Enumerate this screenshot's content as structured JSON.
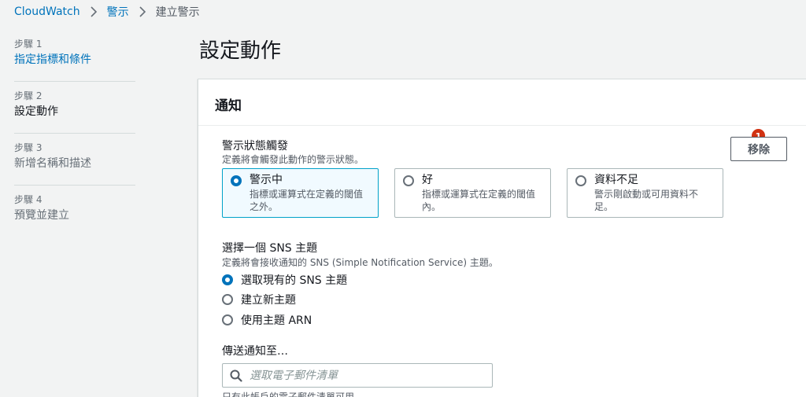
{
  "breadcrumb": {
    "items": [
      "CloudWatch",
      "警示",
      "建立警示"
    ]
  },
  "steps": [
    {
      "num": "步驟 1",
      "label": "指定指標和條件"
    },
    {
      "num": "步驟 2",
      "label": "設定動作"
    },
    {
      "num": "步驟 3",
      "label": "新增名稱和描述"
    },
    {
      "num": "步驟 4",
      "label": "預覽並建立"
    }
  ],
  "page_title": "設定動作",
  "panel": {
    "title": "通知",
    "remove_label": "移除",
    "badge": "1",
    "alarm_state": {
      "title": "警示狀態觸發",
      "desc": "定義將會觸發此動作的警示狀態。",
      "options": [
        {
          "title": "警示中",
          "desc": "指標或運算式在定義的閾值之外。"
        },
        {
          "title": "好",
          "desc": "指標或運算式在定義的閾值內。"
        },
        {
          "title": "資料不足",
          "desc": "警示剛啟動或可用資料不足。"
        }
      ]
    },
    "sns": {
      "title": "選擇一個 SNS 主題",
      "desc": "定義將會接收通知的 SNS (Simple Notification Service) 主題。",
      "options": [
        "選取現有的 SNS 主題",
        "建立新主題",
        "使用主題 ARN"
      ]
    },
    "send_to": {
      "title": "傳送通知至…",
      "placeholder": "選取電子郵件清單",
      "hint": "只有此帳戶的電子郵件清單可用。"
    }
  },
  "colors": {
    "link": "#0073bb",
    "selected_border": "#00a1c9",
    "selected_bg": "#f1faff",
    "badge": "#d13212"
  }
}
